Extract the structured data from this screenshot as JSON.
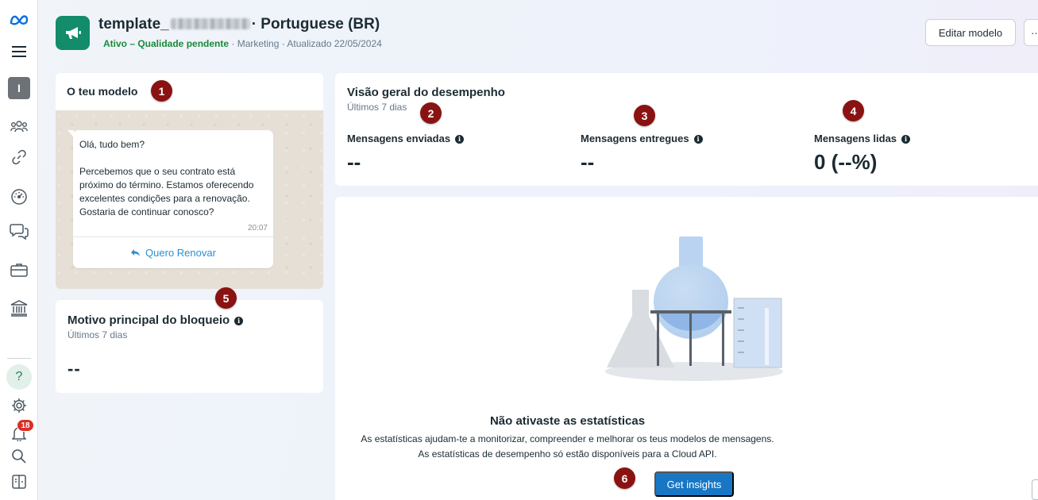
{
  "header": {
    "title_prefix": "template_",
    "title_suffix": "· Portuguese (BR)",
    "status": "Ativo – Qualidade pendente",
    "meta": " · Marketing · Atualizado 22/05/2024",
    "edit_button": "Editar modelo",
    "more_button": "···"
  },
  "rail": {
    "avatar_letter": "I",
    "help_glyph": "?",
    "notification_count": "18",
    "icons": [
      "meta-logo-icon",
      "menu-icon",
      "people-icon",
      "link-icon",
      "gauge-icon",
      "chat-icon",
      "briefcase-icon",
      "bank-icon",
      "help-icon",
      "settings-icon",
      "bell-icon",
      "search-icon",
      "panel-icon"
    ]
  },
  "model_card": {
    "title": "O teu modelo",
    "message": "Olá, tudo bem?\n\nPercebemos que o seu contrato está próximo do término. Estamos oferecendo excelentes condições para a renovação. Gostaria de continuar conosco?",
    "time": "20:07",
    "button_label": "Quero Renovar"
  },
  "block_card": {
    "title": "Motivo principal do bloqueio",
    "subtitle": "Últimos 7 dias",
    "value": "--"
  },
  "performance": {
    "title": "Visão geral do desempenho",
    "subtitle": "Últimos 7 dias",
    "metrics": [
      {
        "label": "Mensagens enviadas",
        "value": "--"
      },
      {
        "label": "Mensagens entregues",
        "value": "--"
      },
      {
        "label": "Mensagens lidas",
        "value": "0 (--%)"
      }
    ]
  },
  "insights": {
    "title": "Não ativaste as estatísticas",
    "description": "As estatísticas ajudam-te a monitorizar, compreender e melhorar os teus modelos de mensagens.\nAs estatísticas de desempenho só estão disponíveis para a Cloud API.",
    "button": "Get insights"
  },
  "markers": [
    "1",
    "2",
    "3",
    "4",
    "5",
    "6"
  ],
  "colors": {
    "brand_green": "#128c6b",
    "status_green": "#1a8a3a",
    "primary_blue": "#1877c5",
    "marker_red": "#8b1212",
    "badge_red": "#d93025"
  }
}
